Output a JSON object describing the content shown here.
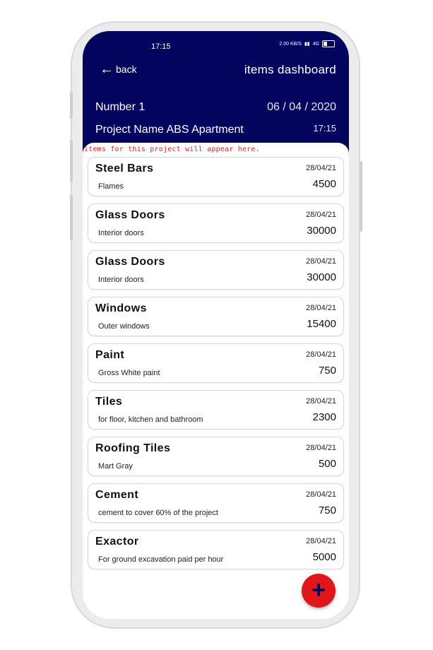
{
  "status_bar": {
    "time": "17:15",
    "network_speed": "2.00 KB/S",
    "signal": "4G"
  },
  "header": {
    "back_label": "back",
    "title": "items dashboard",
    "project_number": "Number 1",
    "project_date": "06 / 04 / 2020",
    "project_name": "Project Name ABS Apartment",
    "project_time": "17:15"
  },
  "hint": "items for this project will appear here.",
  "items": [
    {
      "name": "Steel Bars",
      "description": "Flames",
      "date": "28/04/21",
      "amount": "4500"
    },
    {
      "name": "Glass Doors",
      "description": "Interior doors",
      "date": "28/04/21",
      "amount": "30000"
    },
    {
      "name": "Glass Doors",
      "description": "Interior doors",
      "date": "28/04/21",
      "amount": "30000"
    },
    {
      "name": "Windows",
      "description": "Outer windows",
      "date": "28/04/21",
      "amount": "15400"
    },
    {
      "name": "Paint",
      "description": "Gross White paint",
      "date": "28/04/21",
      "amount": "750"
    },
    {
      "name": "Tiles",
      "description": "for floor, kitchen and bathroom",
      "date": "28/04/21",
      "amount": "2300"
    },
    {
      "name": "Roofing Tiles",
      "description": "Mart Gray",
      "date": "28/04/21",
      "amount": "500"
    },
    {
      "name": "Cement",
      "description": "cement to cover 60% of the project",
      "date": "28/04/21",
      "amount": "750"
    },
    {
      "name": "Exactor",
      "description": "For ground excavation paid per hour",
      "date": "28/04/21",
      "amount": "5000"
    }
  ],
  "fab": {
    "icon": "plus-icon"
  },
  "colors": {
    "header_bg": "#03045e",
    "fab_bg": "#e0161b",
    "hint": "#e02020"
  }
}
